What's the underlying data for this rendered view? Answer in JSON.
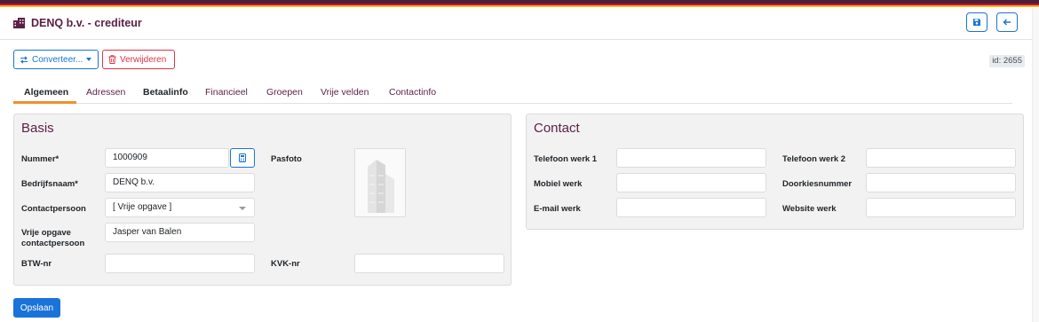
{
  "header": {
    "title": "DENQ b.v.  - crediteur",
    "icons": {
      "title": "building-icon",
      "save": "save-icon",
      "back": "arrow-left-icon"
    }
  },
  "toolbar": {
    "convert_label": "Converteer...",
    "delete_label": "Verwijderen",
    "id_badge": "id: 2655"
  },
  "tabs": [
    "Algemeen",
    "Adressen",
    "Betaalinfo",
    "Financieel",
    "Groepen",
    "Vrije velden",
    "Contactinfo"
  ],
  "basis": {
    "title": "Basis",
    "nummer_label": "Nummer*",
    "nummer_value": "1000909",
    "pasfoto_label": "Pasfoto",
    "bedrijfsnaam_label": "Bedrijfsnaam*",
    "bedrijfsnaam_value": "DENQ b.v.",
    "contactpersoon_label": "Contactpersoon",
    "contactpersoon_value": "[ Vrije opgave ]",
    "vrije_opgave_label_1": "Vrije opgave",
    "vrije_opgave_label_2": "contactpersoon",
    "vrije_opgave_value": "Jasper van Balen",
    "btw_label": "BTW-nr",
    "btw_value": "",
    "kvk_label": "KVK-nr",
    "kvk_value": ""
  },
  "contact": {
    "title": "Contact",
    "tel1_label": "Telefoon werk 1",
    "tel1_value": "",
    "tel2_label": "Telefoon werk 2",
    "tel2_value": "",
    "mobiel_label": "Mobiel werk",
    "mobiel_value": "",
    "doorkies_label": "Doorkiesnummer",
    "doorkies_value": "",
    "email_label": "E-mail werk",
    "email_value": "",
    "website_label": "Website werk",
    "website_value": ""
  },
  "footer": {
    "save_label": "Opslaan"
  },
  "colors": {
    "brand": "#5b1e46",
    "primary": "#1a73d9",
    "danger": "#dc3545",
    "tab_active": "#f0902a"
  }
}
